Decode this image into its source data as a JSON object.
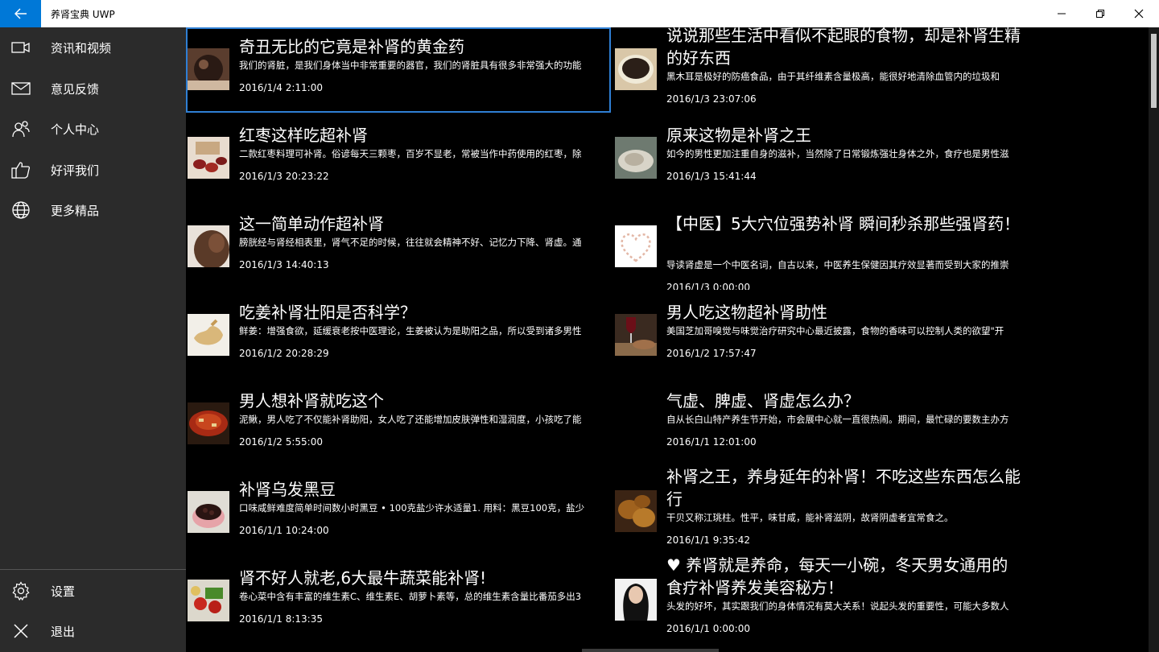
{
  "window": {
    "title": "养肾宝典 UWP",
    "buttons": [
      "minimize-icon",
      "restore-icon",
      "close-icon"
    ]
  },
  "sidebar": {
    "items": [
      {
        "label": "资讯和视频",
        "icon": "video-camera-icon"
      },
      {
        "label": "意见反馈",
        "icon": "mail-icon"
      },
      {
        "label": "个人中心",
        "icon": "people-icon"
      },
      {
        "label": "好评我们",
        "icon": "thumbs-up-icon"
      },
      {
        "label": "更多精品",
        "icon": "globe-icon"
      }
    ],
    "footer": [
      {
        "label": "设置",
        "icon": "gear-icon"
      },
      {
        "label": "退出",
        "icon": "close-icon"
      }
    ]
  },
  "articles": [
    {
      "title": "奇丑无比的它竟是补肾的黄金药",
      "summary": "我们的肾脏，是我们身体当中非常重要的器官，我们的肾脏具有很多非常强大的功能",
      "date": "2016/1/4 2:11:00",
      "thumb": "food",
      "selected": true
    },
    {
      "title": "说说那些生活中看似不起眼的食物，却是补肾生精的好东西",
      "summary": "黑木耳是极好的防癌食品，由于其纤维素含量极高，能很好地清除血管内的垃圾和",
      "date": "2016/1/3 23:07:06",
      "thumb": "soup"
    },
    {
      "title": "红枣这样吃超补肾",
      "summary": "二款红枣料理可补肾。俗谚每天三颗枣，百岁不显老，常被当作中药使用的红枣，除",
      "date": "2016/1/3 20:23:22",
      "thumb": "dates"
    },
    {
      "title": "原来这物是补肾之王",
      "summary": "如今的男性更加注重自身的滋补，当然除了日常锻炼强壮身体之外，食疗也是男性滋",
      "date": "2016/1/3 15:41:44",
      "thumb": "oyster"
    },
    {
      "title": "这一简单动作超补肾",
      "summary": "膀胱经与肾经相表里，肾气不足的时候，往往就会精神不好、记忆力下降、肾虚。通",
      "date": "2016/1/3 14:40:13",
      "thumb": "body"
    },
    {
      "title": "【中医】5大穴位强势补肾 瞬间秒杀那些强肾药！",
      "summary": "导读肾虚是一个中医名词，自古以来，中医养生保健因其疗效显著而受到大家的推崇",
      "date": "2016/1/3 0:00:00",
      "thumb": "heart"
    },
    {
      "title": "吃姜补肾壮阳是否科学？",
      "summary": "鲜姜：增强食欲，延缓衰老按中医理论，生姜被认为是助阳之品，所以受到诸多男性",
      "date": "2016/1/2 20:28:29",
      "thumb": "ginger"
    },
    {
      "title": "男人吃这物超补肾助性",
      "summary": "美国芝加哥嗅觉与味觉治疗研究中心最近披露，食物的香味可以控制人类的欲望\"开",
      "date": "2016/1/2 17:57:47",
      "thumb": "wine"
    },
    {
      "title": "男人想补肾就吃这个",
      "summary": "泥鳅，男人吃了不仅能补肾助阳，女人吃了还能增加皮肤弹性和湿润度，小孩吃了能",
      "date": "2016/1/2 5:55:00",
      "thumb": "stew"
    },
    {
      "title": "气虚、脾虚、肾虚怎么办？",
      "summary": "自从长白山特产养生节开始，市会展中心就一直很热闹。期间，最忙碌的要数主办方",
      "date": "2016/1/1 12:01:00",
      "thumb": "none"
    },
    {
      "title": "补肾乌发黑豆",
      "summary": "口味咸鲜难度简单时间数小时黑豆 • 100克盐少许水适量1. 用料：黑豆100克，盐少",
      "date": "2016/1/1 10:24:00",
      "thumb": "beans"
    },
    {
      "title": "补肾之王，养身延年的补肾！不吃这些东西怎么能行",
      "summary": "干贝又称江珧柱。性平，味甘咸，能补肾滋阴，故肾阴虚者宜常食之。",
      "date": "2016/1/1 9:35:42",
      "thumb": "scallop"
    },
    {
      "title": "肾不好人就老,6大最牛蔬菜能补肾!",
      "summary": "卷心菜中含有丰富的维生素C、维生素E、胡萝卜素等，总的维生素含量比番茄多出3",
      "date": "2016/1/1 8:13:35",
      "thumb": "veg"
    },
    {
      "title": "♥ 养肾就是养命，每天一小碗，冬天男女通用的食疗补肾养发美容秘方！",
      "summary": "头发的好坏，其实跟我们的身体情况有莫大关系！说起头发的重要性，可能大多数人",
      "date": "2016/1/1 0:00:00",
      "thumb": "hair"
    }
  ]
}
